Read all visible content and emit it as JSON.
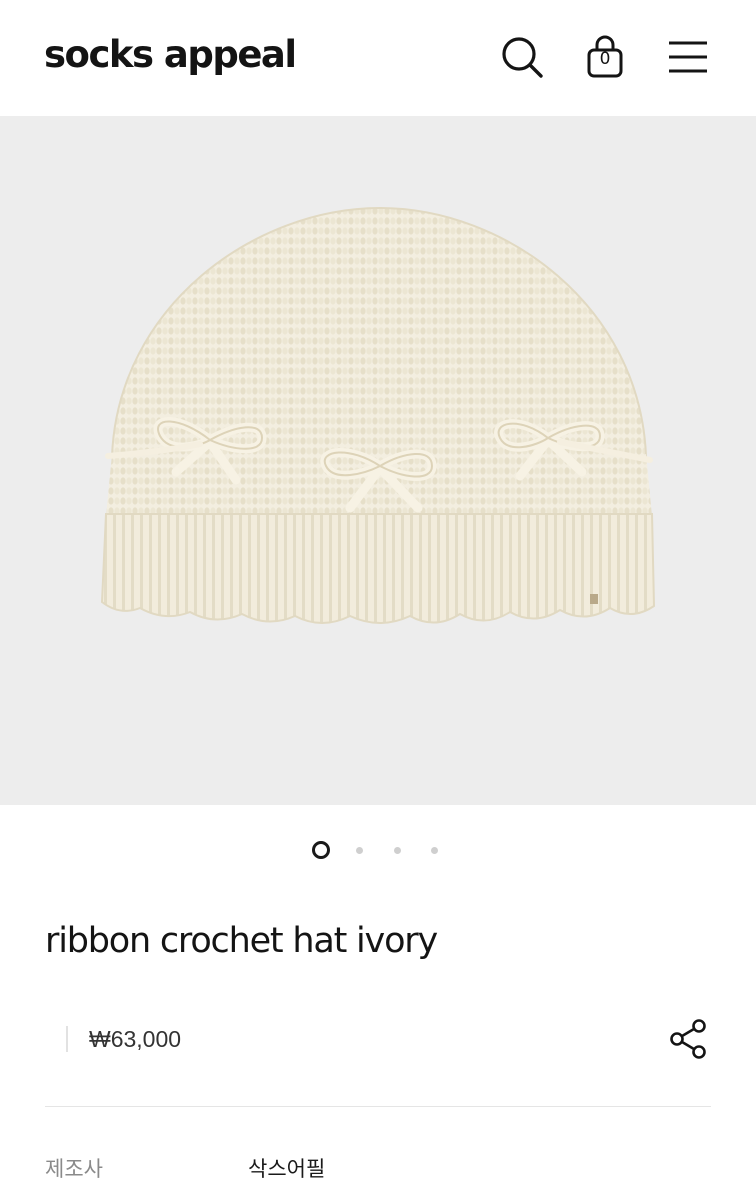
{
  "header": {
    "logo": "socks appeal",
    "cart_count": "0"
  },
  "icons": {
    "search": "search-icon",
    "cart": "shopping-bag-icon",
    "menu": "hamburger-menu-icon",
    "share": "share-icon"
  },
  "carousel": {
    "slide_count": 4,
    "active_index": 0
  },
  "product": {
    "title": "ribbon crochet hat ivory",
    "price": "₩63,000"
  },
  "specs": [
    {
      "label": "제조사",
      "value": "삭스어필"
    }
  ]
}
